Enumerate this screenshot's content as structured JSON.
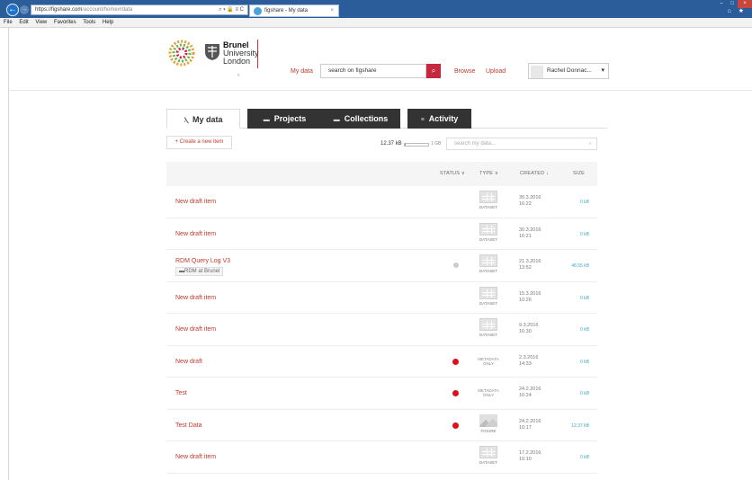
{
  "browser": {
    "url_host": "https://figshare.com",
    "url_path": "/account/home#/data",
    "address_icons": "⌕ ▾ 🔒 ≡ C",
    "tab_title": "figshare - My data",
    "tab_close": "×",
    "menu": [
      "File",
      "Edit",
      "View",
      "Favorites",
      "Tools",
      "Help"
    ],
    "window_controls": [
      "–",
      "□",
      "×"
    ],
    "right_icons": "⌂ ★"
  },
  "header": {
    "uni_line1": "Brunel",
    "uni_line2": "University",
    "uni_line3": "London",
    "caret": "∧",
    "nav_mydata": "My data",
    "search_placeholder": "search on figshare",
    "search_icon": "⌕",
    "nav_browse": "Browse",
    "nav_upload": "Upload",
    "user_name": "Rachel Donnac...",
    "user_caret": "▾"
  },
  "tabs": [
    {
      "label": "My data",
      "icon": "Ⲗ"
    },
    {
      "label": "Projects",
      "icon": "▬"
    },
    {
      "label": "Collections",
      "icon": "▬"
    },
    {
      "label": "Activity",
      "icon": "≡"
    }
  ],
  "toolbar": {
    "create": "+ Create a new item",
    "quota_used": "12.37 kB",
    "quota_fraction": 0.02,
    "quota_max": "1 GB",
    "search_placeholder": "search my data...",
    "search_icon": "⌕"
  },
  "table": {
    "headers": {
      "status": "STATUS ∨",
      "type": "TYPE ∨",
      "created": "CREATED ↓",
      "size": "SIZE"
    },
    "rows": [
      {
        "title": "New draft item",
        "status": "",
        "type": "DATASET",
        "date": "30.3.2016",
        "time": "16:22",
        "size": "0 kB"
      },
      {
        "title": "New draft item",
        "status": "",
        "type": "DATASET",
        "date": "30.3.2016",
        "time": "16:21",
        "size": "0 kB"
      },
      {
        "title": "RDM Query Log V3",
        "project": "RDM at Brunel",
        "status": "grey",
        "type": "DATASET",
        "date": "21.3.2016",
        "time": "13:52",
        "size": "48.55 kB"
      },
      {
        "title": "New draft item",
        "status": "",
        "type": "DATASET",
        "date": "15.3.2016",
        "time": "10:26",
        "size": "0 kB"
      },
      {
        "title": "New draft item",
        "status": "",
        "type": "DATASET",
        "date": "9.3.2016",
        "time": "16:30",
        "size": "0 kB"
      },
      {
        "title": "New draft",
        "status": "red",
        "type": "METADATA ONLY",
        "date": "2.3.2016",
        "time": "14:33",
        "size": "0 kB"
      },
      {
        "title": "Test",
        "status": "red",
        "type": "METADATA ONLY",
        "date": "24.2.2016",
        "time": "16:24",
        "size": "0 kB"
      },
      {
        "title": "Test Data",
        "status": "red",
        "type": "FIGURE",
        "date": "24.2.2016",
        "time": "10:17",
        "size": "12.37 kB"
      },
      {
        "title": "New draft item",
        "status": "",
        "type": "DATASET",
        "date": "17.2.2016",
        "time": "10:10",
        "size": "0 kB"
      }
    ]
  },
  "colors": {
    "accent": "#c5283d",
    "link": "#c0392b",
    "size_text": "#3aa7c6",
    "dark_tab": "#333333",
    "titlebar": "#2a5d9a"
  }
}
